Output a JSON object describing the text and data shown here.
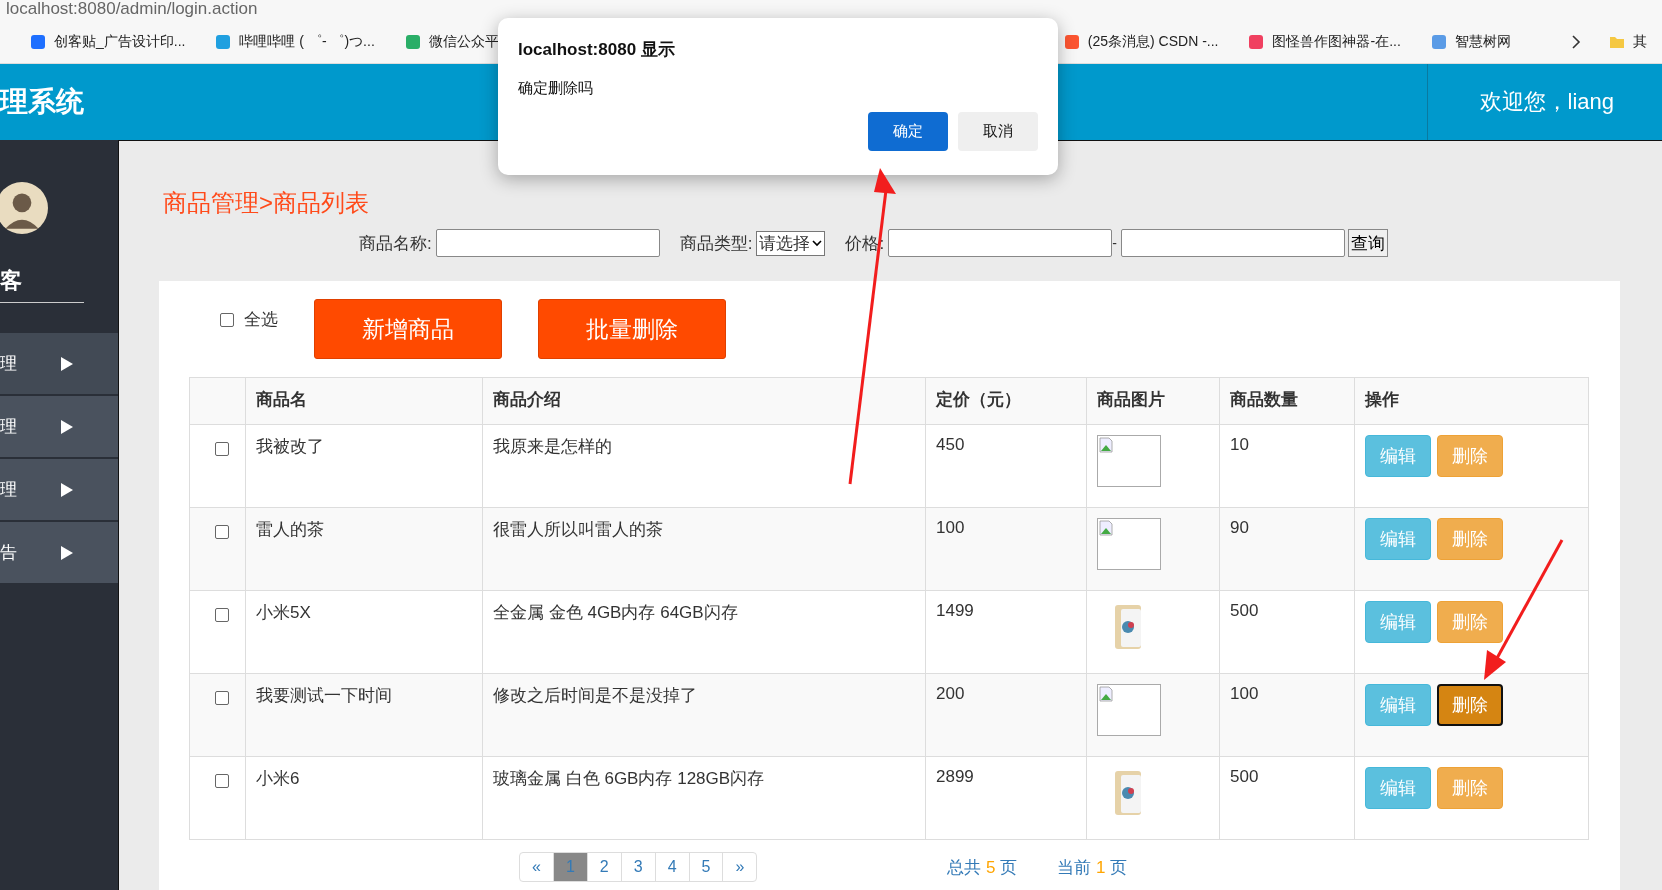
{
  "browser": {
    "address": "localhost:8080/admin/login.action",
    "bookmarks": [
      {
        "label": "创客贴_广告设计印...",
        "color": "#1e6fff"
      },
      {
        "label": "哔哩哔哩 ( ゜- ゜)つ...",
        "color": "#20a0e0"
      },
      {
        "label": "微信公众平",
        "color": "#2aae67"
      },
      {
        "label": "(25条消息) CSDN -...",
        "color": "#fc5531"
      },
      {
        "label": "图怪兽作图神器-在...",
        "color": "#f04060"
      },
      {
        "label": "智慧树网",
        "color": "#5a9be6"
      }
    ],
    "more_folder": "其"
  },
  "dialog": {
    "title": "localhost:8080 显示",
    "message": "确定删除吗",
    "buttons": [
      {
        "label": "确定",
        "kind": "primary"
      },
      {
        "label": "取消",
        "kind": "secondary"
      }
    ]
  },
  "header": {
    "title": "理系统",
    "welcome": "欢迎您，liang"
  },
  "sidebar": {
    "user": "客",
    "items": [
      {
        "label": "理",
        "expanded": false
      },
      {
        "label": "理",
        "expanded": false
      },
      {
        "label": "理",
        "expanded": false
      },
      {
        "label": "告",
        "expanded": false
      }
    ]
  },
  "breadcrumb": "商品管理>商品列表",
  "search": {
    "name_label": "商品名称:",
    "type_label": "商品类型:",
    "type_value": "请选择",
    "price_label": "价格:",
    "separator": "-",
    "query_button": "查询"
  },
  "toolbar": {
    "select_all": {
      "label": "全选",
      "checked": false
    },
    "buttons": [
      "新增商品",
      "批量删除"
    ]
  },
  "table": {
    "columns": [
      "商品名",
      "商品介绍",
      "定价（元）",
      "商品图片",
      "商品数量",
      "操作"
    ],
    "rows": [
      {
        "checked": false,
        "name": "我被改了",
        "intro": "我原来是怎样的",
        "price": "450",
        "image": {
          "kind": "broken"
        },
        "count": "10",
        "edit": "编辑",
        "delete": "删除",
        "focused": false
      },
      {
        "checked": false,
        "name": "雷人的茶",
        "intro": "很雷人所以叫雷人的茶",
        "price": "100",
        "image": {
          "kind": "broken"
        },
        "count": "90",
        "edit": "编辑",
        "delete": "删除",
        "focused": false
      },
      {
        "checked": false,
        "name": "小米5X",
        "intro": "全金属 金色 4GB内存 64GB闪存",
        "price": "1499",
        "count": "500",
        "edit": "编辑",
        "delete": "删除",
        "focused": false
      },
      {
        "checked": false,
        "name": "我要测试一下时间",
        "intro": "修改之后时间是不是没掉了",
        "price": "200",
        "image": {
          "kind": "broken"
        },
        "count": "100",
        "edit": "编辑",
        "delete": "删除",
        "focused": true
      },
      {
        "checked": false,
        "name": "小米6",
        "intro": "玻璃金属 白色 6GB内存 128GB闪存",
        "price": "2899",
        "count": "500",
        "edit": "编辑",
        "delete": "删除",
        "focused": false
      }
    ]
  },
  "pagination": {
    "prev": "«",
    "pages": [
      {
        "label": "1",
        "selected": true
      },
      {
        "label": "2",
        "selected": false
      },
      {
        "label": "3",
        "selected": false
      },
      {
        "label": "4",
        "selected": false
      },
      {
        "label": "5",
        "selected": false
      }
    ],
    "next": "»",
    "total_prefix": "总共",
    "total": "5",
    "total_suffix": "页",
    "current_prefix": "当前",
    "current": "1",
    "current_suffix": "页"
  }
}
